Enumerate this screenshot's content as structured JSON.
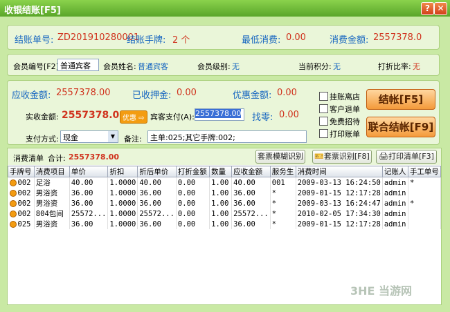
{
  "window": {
    "title": "收银结账[F5]",
    "help": "?",
    "close": "✕"
  },
  "summary": {
    "bill_label": "结账单号:",
    "bill_value": "ZD201910280001",
    "hand_label": "结账手牌:",
    "hand_value": "2 个",
    "min_label": "最低消费:",
    "min_value": "0.00",
    "total_label": "消费金额:",
    "total_value": "2557378.0"
  },
  "member": {
    "id_label": "会员编号[F2]",
    "id_value": "普通宾客",
    "name_label": "会员姓名:",
    "name_value": "普通宾客",
    "level_label": "会员级别:",
    "level_value": "无",
    "points_label": "当前积分:",
    "points_value": "无",
    "discount_label": "打折比率:",
    "discount_value": "无"
  },
  "payment": {
    "due_label": "应收金额:",
    "due_value": "2557378.00",
    "deposit_label": "已收押金:",
    "deposit_value": "0.00",
    "promo_label": "优惠金额:",
    "promo_value": "0.00",
    "actual_label": "实收金额:",
    "actual_value": "2557378.00",
    "promo_badge": "优惠",
    "guest_pay_label": "宾客支付(A):",
    "guest_pay_value": "2557378.00",
    "change_label": "找零:",
    "change_value": "0.00",
    "method_label": "支付方式:",
    "method_value": "现金",
    "note_label": "备注:",
    "note_value": "主单:025;其它手牌:002;"
  },
  "options": [
    "挂账离店",
    "客户退单",
    "免费招待",
    "打印账单"
  ],
  "buttons": {
    "checkout": "结帐[F5]",
    "joint_checkout": "联合结帐[F9]",
    "fuzzy": "套票模糊识别",
    "ticket": "套票识别[F8]",
    "print": "打印清单[F3]"
  },
  "list": {
    "title": "消费清单",
    "sum_label": "合计:",
    "sum_value": "2557378.00",
    "columns": [
      "手牌号",
      "消费项目",
      "单价",
      "折扣",
      "折后单价",
      "打折金额",
      "数量",
      "应收金额",
      "服务生",
      "消费时间",
      "记账人",
      "手工单号"
    ],
    "rows": [
      [
        "002",
        "足浴",
        "40.00",
        "1.0000",
        "40.00",
        "0.00",
        "1.00",
        "40.00",
        "001",
        "2009-03-13 16:24:50",
        "admin",
        "*"
      ],
      [
        "002",
        "男浴资",
        "36.00",
        "1.0000",
        "36.00",
        "0.00",
        "1.00",
        "36.00",
        "*",
        "2009-01-15 12:17:28",
        "admin",
        ""
      ],
      [
        "002",
        "男浴资",
        "36.00",
        "1.0000",
        "36.00",
        "0.00",
        "1.00",
        "36.00",
        "*",
        "2009-03-13 16:24:47",
        "admin",
        "*"
      ],
      [
        "002",
        "804包间",
        "25572...",
        "1.0000",
        "25572...",
        "0.00",
        "1.00",
        "25572...",
        "*",
        "2010-02-05 17:34:30",
        "admin",
        ""
      ],
      [
        "025",
        "男浴资",
        "36.00",
        "1.0000",
        "36.00",
        "0.00",
        "1.00",
        "36.00",
        "*",
        "2009-01-15 12:17:28",
        "admin",
        ""
      ]
    ]
  },
  "watermark": "3HE 当游网"
}
